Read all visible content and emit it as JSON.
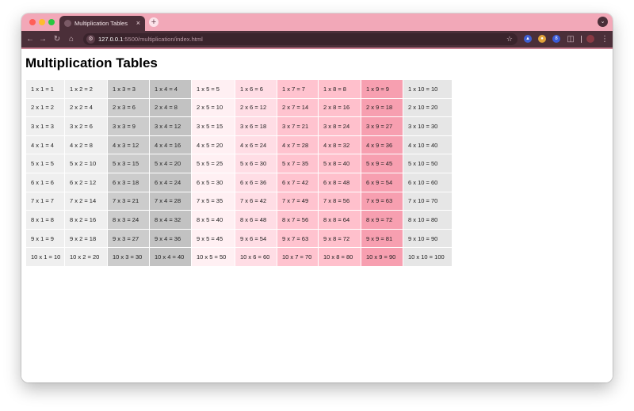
{
  "browser": {
    "tab_title": "Multiplication Tables",
    "tab_close": "×",
    "new_tab": "+",
    "tab_search": "⌄",
    "url_host": "127.0.0.1",
    "url_path": ":5500/multiplication/index.html",
    "extension_badge": "8",
    "icons": [
      "back-icon",
      "forward-icon",
      "reload-icon",
      "home-icon",
      "site-info-icon",
      "bookmark-star-icon",
      "extensions-icon",
      "profile-avatar-icon",
      "menu-icon"
    ]
  },
  "page": {
    "title": "Multiplication Tables"
  },
  "table": {
    "column_colors": [
      "#efefef",
      "#efefef",
      "#cccccc",
      "#c2c2c2",
      "#fff0f3",
      "#ffdde5",
      "#ffc3cf",
      "#ffc0cc",
      "#f79fb0",
      "#e6e6e6"
    ],
    "rows": [
      [
        "1 x 1 = 1",
        "1 x 2 = 2",
        "1 x 3 = 3",
        "1 x 4 = 4",
        "1 x 5 = 5",
        "1 x 6 = 6",
        "1 x 7 = 7",
        "1 x 8 = 8",
        "1 x 9 = 9",
        "1 x 10 = 10"
      ],
      [
        "2 x 1 = 2",
        "2 x 2 = 4",
        "2 x 3 = 6",
        "2 x 4 = 8",
        "2 x 5 = 10",
        "2 x 6 = 12",
        "2 x 7 = 14",
        "2 x 8 = 16",
        "2 x 9 = 18",
        "2 x 10 = 20"
      ],
      [
        "3 x 1 = 3",
        "3 x 2 = 6",
        "3 x 3 = 9",
        "3 x 4 = 12",
        "3 x 5 = 15",
        "3 x 6 = 18",
        "3 x 7 = 21",
        "3 x 8 = 24",
        "3 x 9 = 27",
        "3 x 10 = 30"
      ],
      [
        "4 x 1 = 4",
        "4 x 2 = 8",
        "4 x 3 = 12",
        "4 x 4 = 16",
        "4 x 5 = 20",
        "4 x 6 = 24",
        "4 x 7 = 28",
        "4 x 8 = 32",
        "4 x 9 = 36",
        "4 x 10 = 40"
      ],
      [
        "5 x 1 = 5",
        "5 x 2 = 10",
        "5 x 3 = 15",
        "5 x 4 = 20",
        "5 x 5 = 25",
        "5 x 6 = 30",
        "5 x 7 = 35",
        "5 x 8 = 40",
        "5 x 9 = 45",
        "5 x 10 = 50"
      ],
      [
        "6 x 1 = 6",
        "6 x 2 = 12",
        "6 x 3 = 18",
        "6 x 4 = 24",
        "6 x 5 = 30",
        "6 x 6 = 36",
        "6 x 7 = 42",
        "6 x 8 = 48",
        "6 x 9 = 54",
        "6 x 10 = 60"
      ],
      [
        "7 x 1 = 7",
        "7 x 2 = 14",
        "7 x 3 = 21",
        "7 x 4 = 28",
        "7 x 5 = 35",
        "7 x 6 = 42",
        "7 x 7 = 49",
        "7 x 8 = 56",
        "7 x 9 = 63",
        "7 x 10 = 70"
      ],
      [
        "8 x 1 = 8",
        "8 x 2 = 16",
        "8 x 3 = 24",
        "8 x 4 = 32",
        "8 x 5 = 40",
        "8 x 6 = 48",
        "8 x 7 = 56",
        "8 x 8 = 64",
        "8 x 9 = 72",
        "8 x 10 = 80"
      ],
      [
        "9 x 1 = 9",
        "9 x 2 = 18",
        "9 x 3 = 27",
        "9 x 4 = 36",
        "9 x 5 = 45",
        "9 x 6 = 54",
        "9 x 7 = 63",
        "9 x 8 = 72",
        "9 x 9 = 81",
        "9 x 10 = 90"
      ],
      [
        "10 x 1 = 10",
        "10 x 2 = 20",
        "10 x 3 = 30",
        "10 x 4 = 40",
        "10 x 5 = 50",
        "10 x 6 = 60",
        "10 x 7 = 70",
        "10 x 8 = 80",
        "10 x 9 = 90",
        "10 x 10 = 100"
      ]
    ]
  }
}
